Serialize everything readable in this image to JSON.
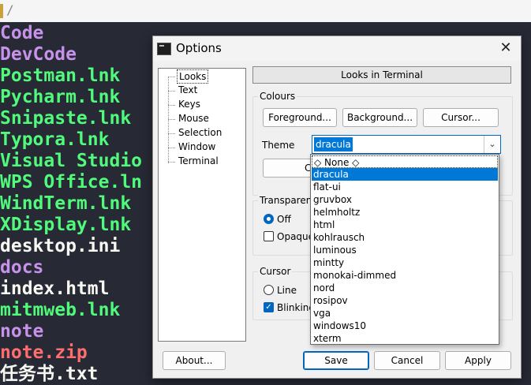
{
  "terminal": {
    "path": "/",
    "lines": [
      {
        "text": "Code",
        "color": "#c792ea"
      },
      {
        "text": "DevCode",
        "color": "#c792ea"
      },
      {
        "text": "Postman.lnk",
        "color": "#50fa7b"
      },
      {
        "text": "Pycharm.lnk",
        "color": "#50fa7b"
      },
      {
        "text": "Snipaste.lnk",
        "color": "#50fa7b"
      },
      {
        "text": "Typora.lnk",
        "color": "#50fa7b"
      },
      {
        "text": "Visual Studio",
        "color": "#50fa7b"
      },
      {
        "text": "WPS Office.ln",
        "color": "#50fa7b"
      },
      {
        "text": "WindTerm.lnk",
        "color": "#50fa7b"
      },
      {
        "text": "XDisplay.lnk",
        "color": "#50fa7b"
      },
      {
        "text": "desktop.ini",
        "color": "#f8f8f2"
      },
      {
        "text": "docs",
        "color": "#c792ea"
      },
      {
        "text": "index.html",
        "color": "#f8f8f2"
      },
      {
        "text": "mitmweb.lnk",
        "color": "#50fa7b"
      },
      {
        "text": "note",
        "color": "#c792ea"
      },
      {
        "text": "note.zip",
        "color": "#ff6e6e"
      },
      {
        "text": "任务书.txt",
        "color": "#f8f8f2"
      }
    ]
  },
  "dialog": {
    "title": "Options",
    "close_glyph": "✕",
    "tree": [
      "Looks",
      "Text",
      "Keys",
      "Mouse",
      "Selection",
      "Window",
      "Terminal"
    ],
    "page_header": "Looks in Terminal",
    "colours": {
      "label": "Colours",
      "foreground": "Foreground...",
      "background": "Background...",
      "cursor": "Cursor..."
    },
    "theme": {
      "label": "Theme",
      "value": "dracula",
      "hidden_button_partial": "C"
    },
    "transparency": {
      "label": "Transparen",
      "off": "Off",
      "opaque": "Opaque"
    },
    "cursor_group": {
      "label": "Cursor",
      "line": "Line",
      "blinking": "Blinking"
    },
    "buttons": {
      "about": "About...",
      "save": "Save",
      "cancel": "Cancel",
      "apply": "Apply"
    }
  },
  "dropdown": {
    "items": [
      "◇ None ◇",
      "dracula",
      "flat-ui",
      "gruvbox",
      "helmholtz",
      "html",
      "kohlrausch",
      "luminous",
      "mintty",
      "monokai-dimmed",
      "nord",
      "rosipov",
      "vga",
      "windows10",
      "xterm"
    ],
    "selected_index": 1,
    "colors": {
      "selection": "#0078d7"
    }
  }
}
